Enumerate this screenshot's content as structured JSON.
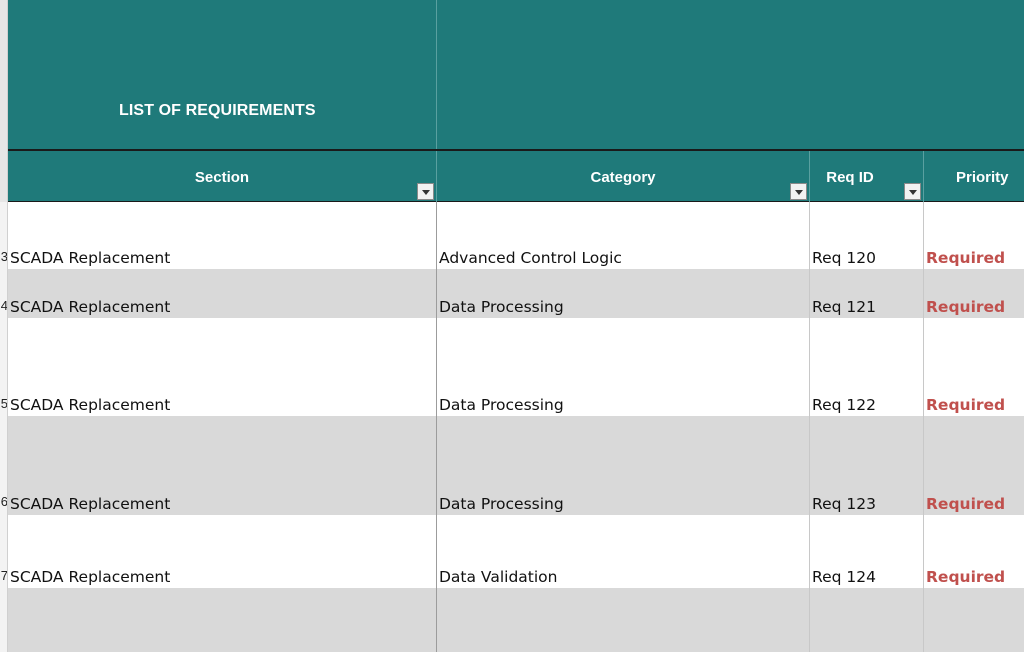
{
  "title": "LIST OF REQUIREMENTS",
  "columns": [
    {
      "label": "Section"
    },
    {
      "label": "Category"
    },
    {
      "label": "Req ID"
    },
    {
      "label": "Priority"
    }
  ],
  "row_numbers": [
    "3",
    "4",
    "5",
    "6",
    "7"
  ],
  "rows": [
    {
      "section": "SCADA Replacement",
      "category": "Advanced Control Logic",
      "req_id": "Req 120",
      "priority": "Required"
    },
    {
      "section": "SCADA Replacement",
      "category": "Data Processing",
      "req_id": "Req 121",
      "priority": "Required"
    },
    {
      "section": "SCADA Replacement",
      "category": "Data Processing",
      "req_id": "Req 122",
      "priority": "Required"
    },
    {
      "section": "SCADA Replacement",
      "category": "Data Processing",
      "req_id": "Req 123",
      "priority": "Required"
    },
    {
      "section": "SCADA Replacement",
      "category": "Data Validation",
      "req_id": "Req 124",
      "priority": "Required"
    }
  ],
  "colors": {
    "header": "#1f7a7a",
    "band": "#d9d9d9",
    "priority_required": "#c0504d"
  }
}
